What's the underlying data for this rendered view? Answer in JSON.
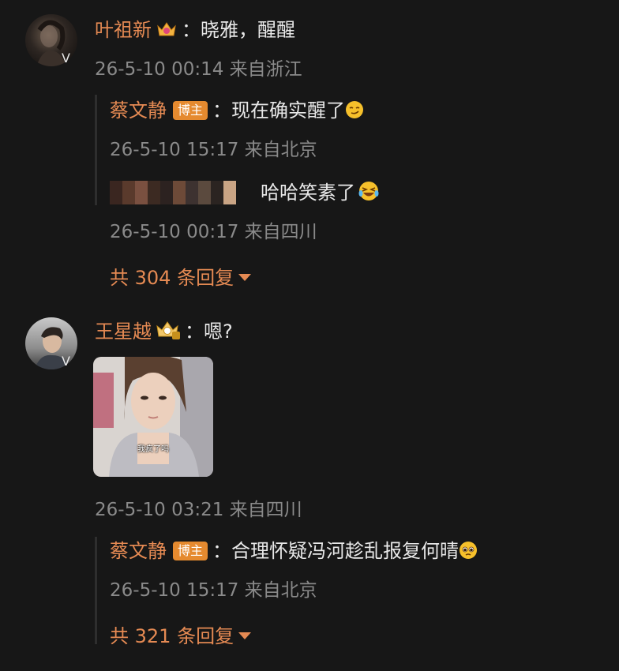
{
  "comments": [
    {
      "user": "叶祖新",
      "separator": "：",
      "text": "晓雅，醒醒",
      "meta": "26-5-10 00:14 来自浙江",
      "verified_mark": "V",
      "replies": [
        {
          "user": "蔡文静",
          "tag": "博主",
          "separator": "：",
          "text": "现在确实醒了",
          "emoji": "smirk-emoji",
          "meta": "26-5-10 15:17 来自北京"
        },
        {
          "user_hidden": true,
          "text": "哈哈笑素了",
          "emoji": "laugh-cry-emoji",
          "meta": "26-5-10 00:17 来自四川"
        }
      ],
      "more_replies": "共 304 条回复"
    },
    {
      "user": "王星越",
      "separator": "：",
      "text": "嗯?",
      "image_caption": "我疯了吗",
      "meta": "26-5-10 03:21 来自四川",
      "verified_mark": "V",
      "replies": [
        {
          "user": "蔡文静",
          "tag": "博主",
          "separator": "：",
          "text": "合理怀疑冯河趁乱报复何晴",
          "emoji": "pleading-emoji",
          "meta": "26-5-10 15:17 来自北京"
        }
      ],
      "more_replies": "共 321 条回复"
    }
  ],
  "colors": {
    "background": "#171717",
    "username": "#e58a53",
    "meta": "#8a8a8a",
    "tag": "#e58a2f",
    "verified": "#f08a24"
  }
}
